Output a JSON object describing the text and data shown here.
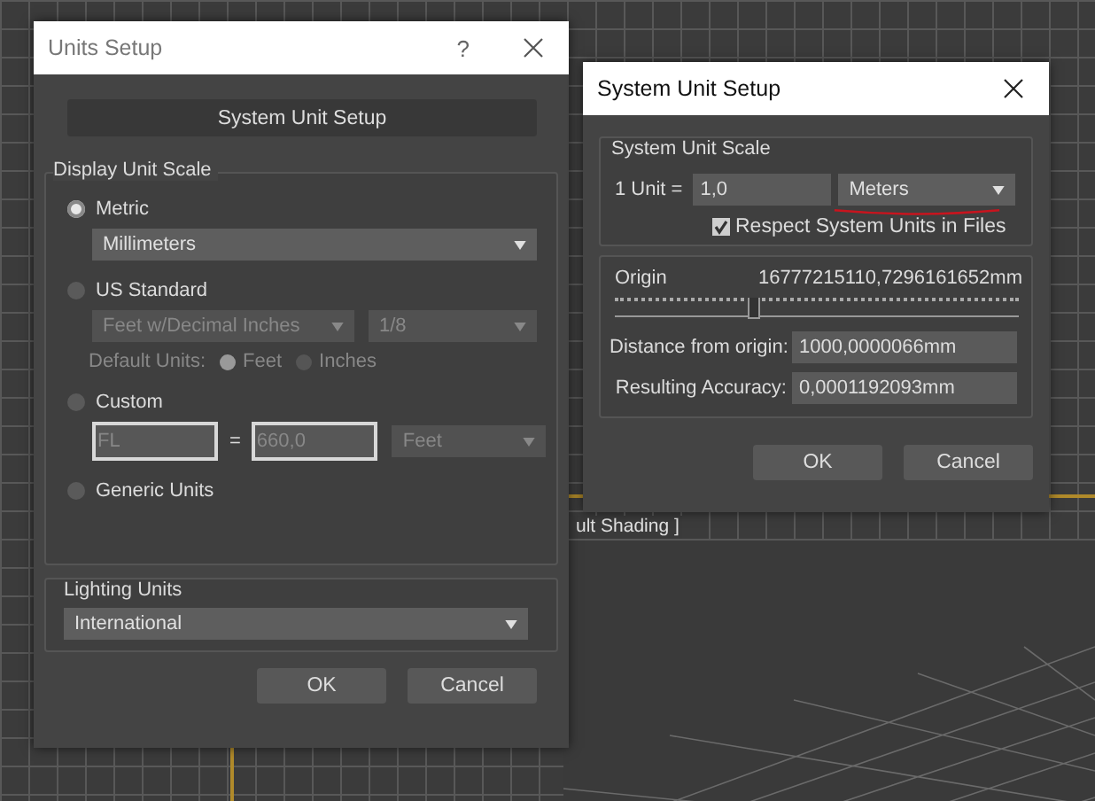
{
  "viewport": {
    "label": "ult Shading ]"
  },
  "units_setup": {
    "title": "Units Setup",
    "help": "?",
    "system_button": "System Unit Setup",
    "display_scale": {
      "title": "Display Unit Scale",
      "options": [
        {
          "kind": "metric",
          "label": "Metric",
          "selected": true,
          "disabled": false,
          "dropdown": "Millimeters"
        },
        {
          "kind": "us",
          "label": "US Standard",
          "selected": false,
          "disabled": true,
          "dropdowns": [
            "Feet w/Decimal Inches",
            "1/8"
          ],
          "default_label": "Default Units:",
          "choices": [
            {
              "label": "Feet",
              "selected": true
            },
            {
              "label": "Inches",
              "selected": false
            }
          ]
        },
        {
          "kind": "custom",
          "label": "Custom",
          "selected": false,
          "disabled": true,
          "name": "FL",
          "equals": "=",
          "value": "660,0",
          "dropdown": "Feet"
        },
        {
          "kind": "generic",
          "label": "Generic Units",
          "selected": false
        }
      ]
    },
    "lighting": {
      "title": "Lighting Units",
      "dropdown": "International"
    },
    "buttons": [
      "OK",
      "Cancel"
    ]
  },
  "system_setup": {
    "title": "System Unit Setup",
    "scale": {
      "title": "System Unit Scale",
      "unit_label": "1 Unit =",
      "value": "1,0",
      "unit": "Meters",
      "respect": {
        "label": "Respect System Units in Files",
        "checked": true
      }
    },
    "origin": {
      "label": "Origin",
      "reading": "16777215110,7296161652mm",
      "level": 0.33
    },
    "fields": [
      {
        "label": "Distance from origin:",
        "value": "1000,0000066mm"
      },
      {
        "label": "Resulting Accuracy:",
        "value": "0,0001192093mm"
      }
    ],
    "buttons": [
      "OK",
      "Cancel"
    ]
  }
}
